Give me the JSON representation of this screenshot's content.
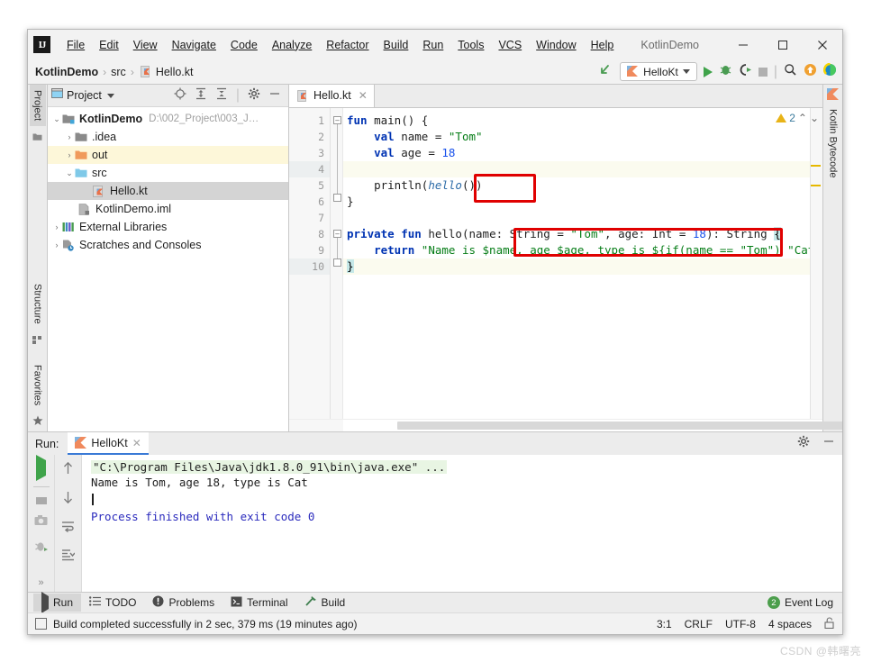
{
  "window": {
    "title": "KotlinDemo",
    "minimize_label": "—",
    "maximize_label": "□",
    "close_label": "✕"
  },
  "menu": [
    {
      "label": "File",
      "accel": "F"
    },
    {
      "label": "Edit",
      "accel": "E"
    },
    {
      "label": "View",
      "accel": "V"
    },
    {
      "label": "Navigate",
      "accel": "N"
    },
    {
      "label": "Code",
      "accel": "C"
    },
    {
      "label": "Analyze",
      "accel": "z"
    },
    {
      "label": "Refactor",
      "accel": "R"
    },
    {
      "label": "Build",
      "accel": "B"
    },
    {
      "label": "Run",
      "accel": "u"
    },
    {
      "label": "Tools",
      "accel": "T"
    },
    {
      "label": "VCS",
      "accel": "S"
    },
    {
      "label": "Window",
      "accel": "W"
    },
    {
      "label": "Help",
      "accel": "H"
    }
  ],
  "navbar": {
    "crumbs": [
      "KotlinDemo",
      "src",
      "Hello.kt"
    ],
    "separator": "›",
    "run_config": "HelloKt",
    "icons": [
      "back-arrow-icon",
      "run-icon",
      "debug-icon",
      "coverage-icon",
      "stop-icon",
      "search-everywhere-icon",
      "update-project-icon",
      "ide-perspective-icon"
    ]
  },
  "left_strip": {
    "top_tab": "Project",
    "bottom_tabs": [
      "Structure",
      "Favorites"
    ]
  },
  "right_strip": {
    "tab": "Kotlin Bytecode"
  },
  "project_panel": {
    "title": "Project",
    "toolbar_icons": [
      "locate-icon",
      "expand-all-icon",
      "collapse-all-icon",
      "gear-icon",
      "hide-icon"
    ],
    "tree": [
      {
        "indent": 0,
        "arrow": "⌄",
        "icon": "module-folder",
        "label": "KotlinDemo",
        "bold": true,
        "path": "D:\\002_Project\\003_J…",
        "state": "normal"
      },
      {
        "indent": 1,
        "arrow": "›",
        "icon": "folder-gray",
        "label": ".idea",
        "bold": false,
        "path": "",
        "state": "normal"
      },
      {
        "indent": 1,
        "arrow": "›",
        "icon": "folder-orange",
        "label": "out",
        "bold": false,
        "path": "",
        "state": "highlight"
      },
      {
        "indent": 1,
        "arrow": "⌄",
        "icon": "folder-blue",
        "label": "src",
        "bold": false,
        "path": "",
        "state": "normal"
      },
      {
        "indent": 3,
        "arrow": "",
        "icon": "kotlin-file",
        "label": "Hello.kt",
        "bold": false,
        "path": "",
        "state": "selected"
      },
      {
        "indent": 2,
        "arrow": "",
        "icon": "iml-file",
        "label": "KotlinDemo.iml",
        "bold": false,
        "path": "",
        "state": "normal"
      },
      {
        "indent": 0,
        "arrow": "›",
        "icon": "libraries",
        "label": "External Libraries",
        "bold": false,
        "path": "",
        "state": "normal"
      },
      {
        "indent": 0,
        "arrow": "›",
        "icon": "scratches",
        "label": "Scratches and Consoles",
        "bold": false,
        "path": "",
        "state": "normal"
      }
    ]
  },
  "editor": {
    "tab_label": "Hello.kt",
    "tab_close": "✕",
    "warning_count": "2",
    "chevron_up": "⌃",
    "chevron_down": "⌄",
    "line_numbers": [
      "1",
      "2",
      "3",
      "4",
      "5",
      "6",
      "7",
      "8",
      "9",
      "10"
    ],
    "code_lines": [
      "fun main() {",
      "    val name = \"Tom\"",
      "    val age = 18",
      "",
      "    println(hello())",
      "}",
      "",
      "private fun hello(name: String = \"Tom\", age: Int = 18): String {",
      "    return \"Name is $name, age $age, type is ${if(name == \"Tom\") \"Cat",
      "}"
    ]
  },
  "run_panel": {
    "label": "Run:",
    "tab": "HelloKt",
    "tab_close": "✕",
    "header_icons": [
      "gear-icon",
      "hide-icon"
    ],
    "toolbar_icons": [
      "rerun-icon",
      "stop-icon",
      "screenshot-icon",
      "dump-threads-icon",
      "expand-more-icon"
    ],
    "toolbar2_icons": [
      "up-icon",
      "down-icon",
      "soft-wrap-icon",
      "scroll-to-end-icon",
      "expand-more-icon"
    ],
    "console": {
      "command": "\"C:\\Program Files\\Java\\jdk1.8.0_91\\bin\\java.exe\" ...",
      "output": "Name is Tom, age 18, type is Cat",
      "exit": "Process finished with exit code 0"
    }
  },
  "bottom_toolbar": {
    "items": [
      {
        "label": "Run",
        "icon": "run-icon",
        "active": true
      },
      {
        "label": "TODO",
        "icon": "todo-icon",
        "active": false
      },
      {
        "label": "Problems",
        "icon": "problems-icon",
        "active": false
      },
      {
        "label": "Terminal",
        "icon": "terminal-icon",
        "active": false
      },
      {
        "label": "Build",
        "icon": "build-icon",
        "active": false
      }
    ],
    "event_log": "Event Log",
    "event_count": "2"
  },
  "statusbar": {
    "message": "Build completed successfully in 2 sec, 379 ms (19 minutes ago)",
    "caret_position": "3:1",
    "line_separator": "CRLF",
    "encoding": "UTF-8",
    "indent": "4 spaces",
    "lock_icon": "unlocked-icon"
  },
  "watermark": "CSDN @韩曙亮",
  "colors": {
    "accent_blue": "#3a7ad6",
    "keyword": "#0033b3",
    "string": "#067d17",
    "number": "#1750eb",
    "warning": "#e8b317",
    "red_annotation": "#e00000",
    "run_green": "#3fa34a"
  }
}
